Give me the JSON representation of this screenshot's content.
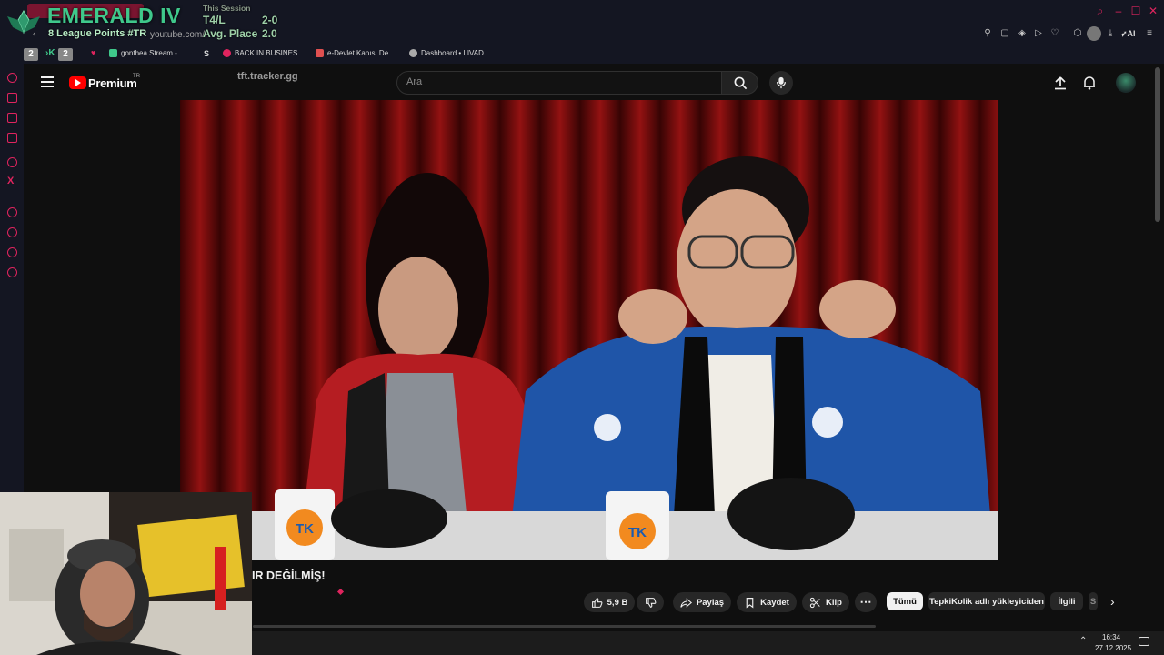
{
  "overlay": {
    "rank": "EMERALD IV",
    "league_points": "8 League Points #TR",
    "session_label": "This Session",
    "stat1_label": "T4/L",
    "stat1_value": "2-0",
    "stat2_label": "Avg. Place",
    "stat2_value": "2.0"
  },
  "browser": {
    "url_fragment": "youtube.com/",
    "ai_label": "AI",
    "badges": [
      "2",
      "2"
    ]
  },
  "bookmarks": [
    {
      "label": "gonthea Stream -...",
      "icon_color": "#3fc88b"
    },
    {
      "label": "BACK IN BUSINES...",
      "icon_color": "#e0245e"
    },
    {
      "label": "e-Devlet Kapısı De...",
      "icon_color": "#e05050"
    },
    {
      "label": "Dashboard • LIVAD",
      "icon_color": "#aaaaaa"
    }
  ],
  "youtube": {
    "premium_label": "Premium",
    "country": "TR",
    "search_placeholder": "Ara",
    "overlay_site": "tft.tracker.gg"
  },
  "video": {
    "title_fragment": "IR DEĞİLMİŞ!",
    "mug_text": "TK"
  },
  "actions": {
    "like_count": "5,9 B",
    "share": "Paylaş",
    "save": "Kaydet",
    "clip": "Klip",
    "more": "⋯"
  },
  "chips": [
    "Tümü",
    "TepkiKolik adlı yükleyiciden",
    "İlgili",
    "S"
  ],
  "taskbar": {
    "time": "16:34",
    "date": "27.12.2025"
  },
  "colors": {
    "accent": "#e0245e",
    "emerald": "#3fc88b",
    "youtube_red": "#ff0000"
  }
}
